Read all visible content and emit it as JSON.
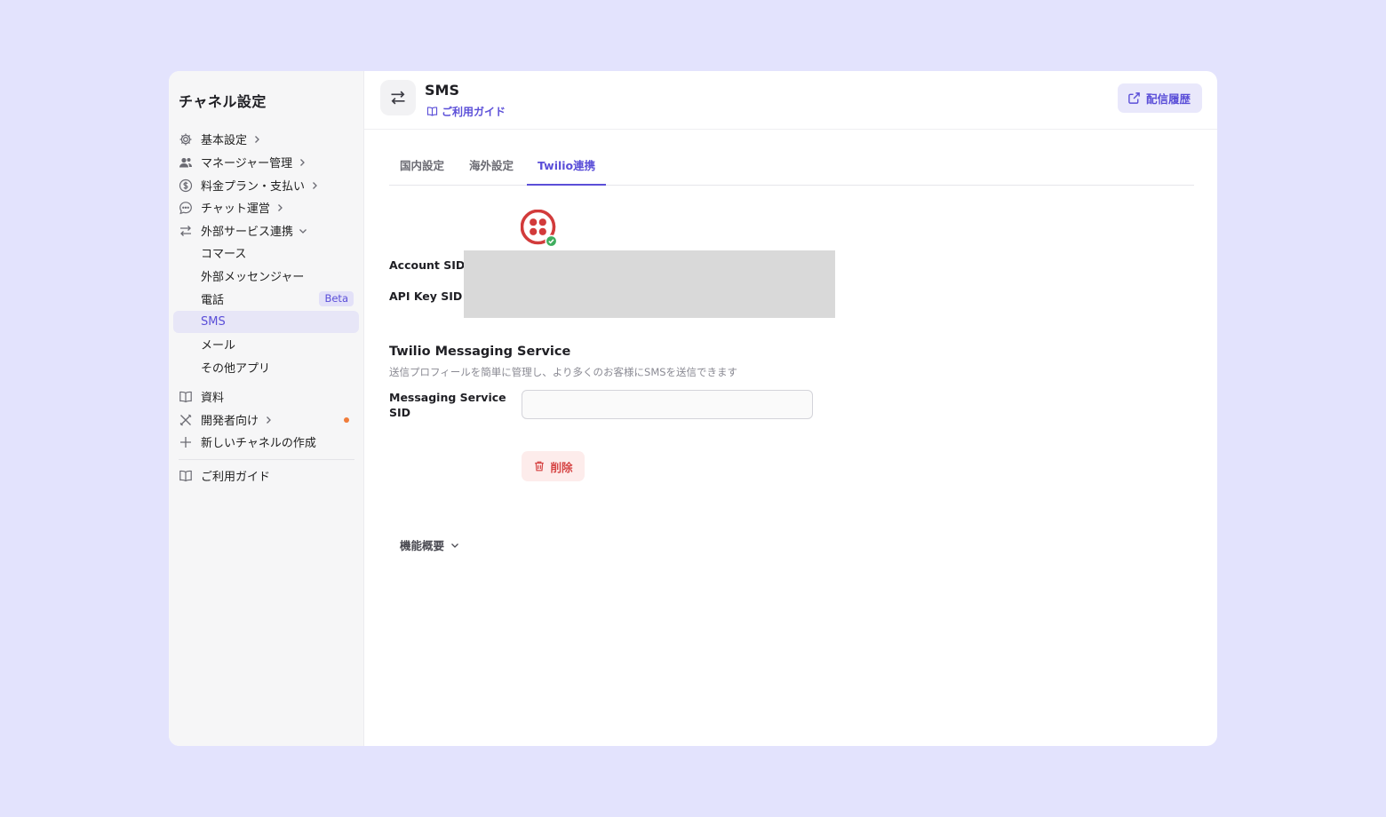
{
  "sidebar": {
    "title": "チャネル設定",
    "items": [
      {
        "label": "基本設定",
        "icon": "gear-icon"
      },
      {
        "label": "マネージャー管理",
        "icon": "users-icon"
      },
      {
        "label": "料金プラン・支払い",
        "icon": "dollar-icon"
      },
      {
        "label": "チャット運営",
        "icon": "chat-icon"
      },
      {
        "label": "外部サービス連携",
        "icon": "transfer-icon"
      },
      {
        "label": "コマース"
      },
      {
        "label": "外部メッセンジャー"
      },
      {
        "label": "電話",
        "badge": "Beta"
      },
      {
        "label": "SMS",
        "active": true
      },
      {
        "label": "メール"
      },
      {
        "label": "その他アプリ"
      },
      {
        "label": "資料",
        "icon": "book-icon"
      },
      {
        "label": "開発者向け",
        "icon": "tools-icon",
        "notification_dot": true
      },
      {
        "label": "新しいチャネルの作成",
        "icon": "plus-icon"
      },
      {
        "label": "ご利用ガイド",
        "icon": "book-icon"
      }
    ]
  },
  "header": {
    "title": "SMS",
    "guide_label": "ご利用ガイド",
    "history_label": "配信履歴"
  },
  "tabs": [
    {
      "label": "国内設定"
    },
    {
      "label": "海外設定"
    },
    {
      "label": "Twilio連携",
      "active": true
    }
  ],
  "credentials": {
    "account_sid_label": "Account SID",
    "api_key_sid_label": "API Key SID"
  },
  "messaging_service": {
    "title": "Twilio Messaging Service",
    "description": "送信プロフィールを簡単に管理し、より多くのお客様にSMSを送信できます",
    "sid_label_line1": "Messaging Service",
    "sid_label_line2": "SID",
    "sid_value": "",
    "delete_label": "削除"
  },
  "feature_overview_label": "機能概要",
  "colors": {
    "accent": "#5b4fd8",
    "background": "#e3e3fd",
    "twilio_red": "#d23b3b",
    "connected_green": "#3fae5e",
    "danger": "#d64545"
  }
}
